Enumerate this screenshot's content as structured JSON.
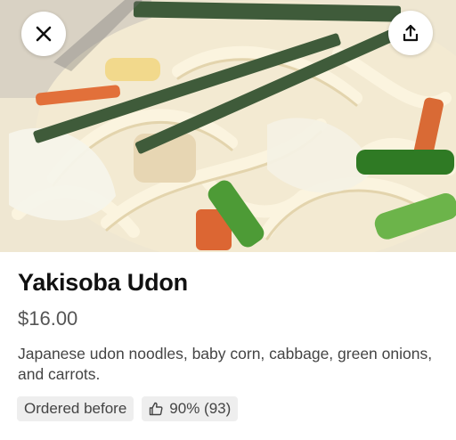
{
  "header": {
    "close_icon": "close-icon",
    "share_icon": "share-icon"
  },
  "item": {
    "name": "Yakisoba Udon",
    "price": "$16.00",
    "description": "Japanese udon noodles, baby corn, cabbage, green onions, and carrots."
  },
  "badges": {
    "ordered_before": "Ordered before",
    "rating_icon": "thumbs-up-icon",
    "rating": "90% (93)"
  },
  "colors": {
    "title": "#111111",
    "price": "#555555",
    "chip_bg": "#eeeeee"
  }
}
